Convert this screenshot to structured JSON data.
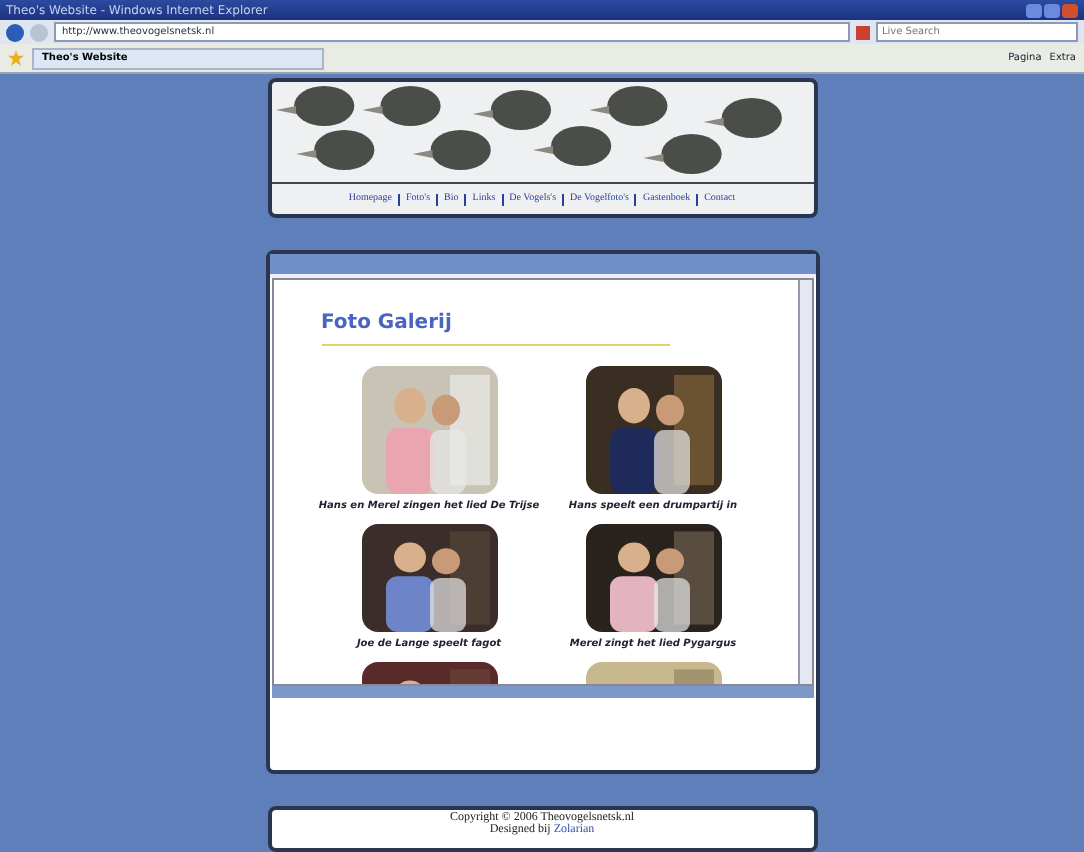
{
  "window": {
    "title": "Theo's Website - Windows Internet Explorer"
  },
  "address_bar": {
    "url": "http://www.theovogelsnetsk.nl",
    "search_placeholder": "Live Search"
  },
  "favorites_bar": {
    "tab": "Theo's Website",
    "commands": [
      {
        "label": "Pagina"
      },
      {
        "label": "Extra"
      }
    ]
  },
  "nav": [
    {
      "label": "Homepage"
    },
    {
      "label": "Foto's"
    },
    {
      "label": "Bio"
    },
    {
      "label": "Links"
    },
    {
      "label": "De Vogels's"
    },
    {
      "label": "De Vogelfoto's"
    },
    {
      "label": "Gastenboek"
    },
    {
      "label": "Contact"
    }
  ],
  "gallery": {
    "title": "Foto Galerij",
    "photos": [
      {
        "caption": "Hans en Merel zingen het lied De Trijse",
        "kind": "picture"
      },
      {
        "caption": "Hans speelt een drumpartij in",
        "kind": "picture"
      },
      {
        "caption": "Joe de Lange speelt fagot",
        "kind": "picture"
      },
      {
        "caption": "Merel zingt het lied Pygargus",
        "kind": "picture"
      },
      {
        "kind": "picture"
      },
      {
        "kind": "picture"
      }
    ]
  },
  "footer": {
    "copyright": "Copyright © 2006 Theovogelsnetsk.nl",
    "designed_by": "Designed bij",
    "designer": "Zolarian"
  }
}
